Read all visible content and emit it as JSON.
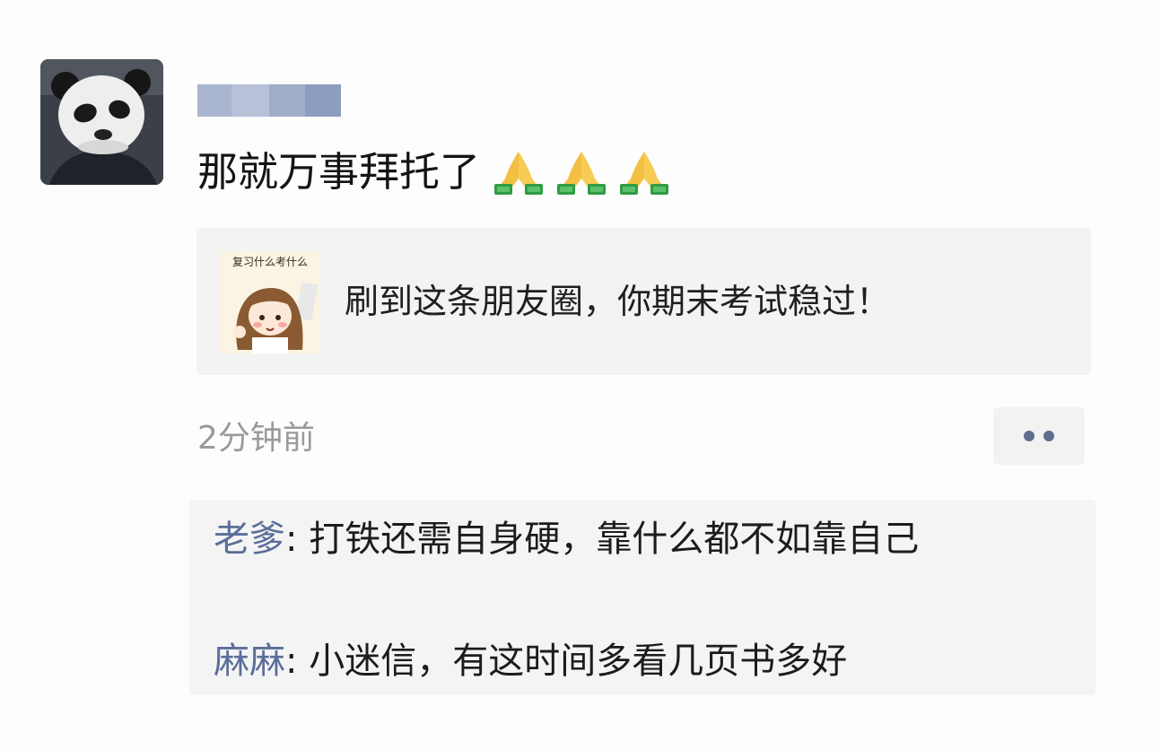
{
  "post": {
    "author_name": "",
    "text": "那就万事拜托了",
    "emojis": [
      "pray-icon",
      "pray-icon",
      "pray-icon"
    ],
    "link": {
      "title": "刷到这条朋友圈，你期末考试稳过！",
      "thumb_text": "复习什么考什么"
    },
    "timestamp": "2分钟前"
  },
  "comments": [
    {
      "name": "老爹",
      "sep": ": ",
      "text": "打铁还需自身硬，靠什么都不如靠自己"
    },
    {
      "name": "麻麻",
      "sep": ": ",
      "text": "小迷信，有这时间多看几页书多好"
    }
  ],
  "colors": {
    "commenter": "#5b6e99",
    "timestamp": "#9a9a9a",
    "card_bg": "#f3f3f3",
    "comment_bg": "#f4f4f4"
  }
}
